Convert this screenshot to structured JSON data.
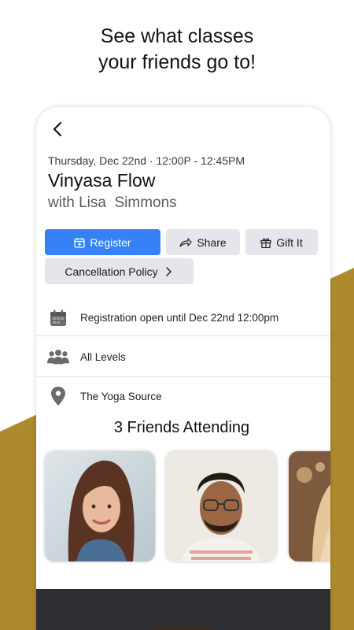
{
  "promo": {
    "headline": "See what classes\nyour friends go to!"
  },
  "colors": {
    "gold": "#ad8a2b",
    "accent": "#3482f6",
    "button_gray": "#e4e6eb"
  },
  "class": {
    "datetime": "Thursday, Dec 22nd · 12:00P - 12:45PM",
    "title": "Vinyasa Flow",
    "instructor": "with Lisa  Simmons"
  },
  "actions": {
    "register_label": "Register",
    "share_label": "Share",
    "gift_label": "Gift It",
    "policy_label": "Cancellation Policy"
  },
  "info": {
    "registration": "Registration open until Dec 22nd 12:00pm",
    "level": "All Levels",
    "location": "The Yoga Source"
  },
  "friends": {
    "heading": "3 Friends Attending",
    "cards": [
      {
        "icon": "friend-photo-woman-brown-hair"
      },
      {
        "icon": "friend-photo-man-glasses"
      },
      {
        "icon": "friend-photo-woman-blonde"
      }
    ]
  },
  "icons": {
    "back": "chevron-left-icon",
    "register": "calendar-plus-icon",
    "share": "share-arrow-icon",
    "gift": "gift-icon",
    "policy": "chevron-right-icon",
    "registration": "calendar-icon",
    "level": "people-icon",
    "location": "map-pin-icon"
  }
}
